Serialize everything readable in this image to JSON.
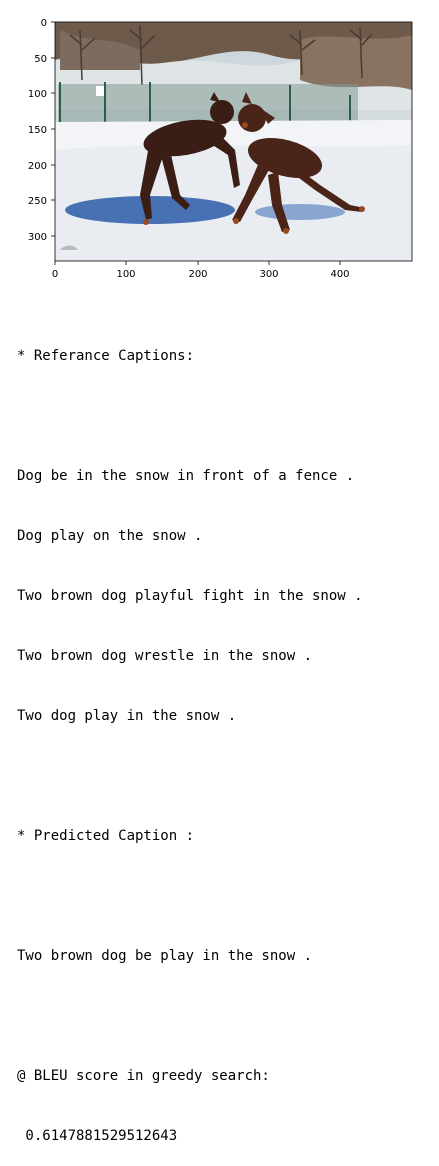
{
  "image_axes": {
    "x_ticks": [
      "0",
      "100",
      "200",
      "300",
      "400"
    ],
    "y_ticks": [
      "0",
      "50",
      "100",
      "150",
      "200",
      "250",
      "300"
    ]
  },
  "output": {
    "reference_header": "* Referance Captions:",
    "reference_captions": [
      "Dog be in the snow in front of a fence .",
      "Dog play on the snow .",
      "Two brown dog playful fight in the snow .",
      "Two brown dog wrestle in the snow .",
      "Two dog play in the snow ."
    ],
    "predicted_header": "* Predicted Caption :",
    "predicted_caption": "Two brown dog be play in the snow .",
    "bleu_label": "@ BLEU score in greedy search:",
    "bleu_value": " 0.6147881529512643"
  }
}
